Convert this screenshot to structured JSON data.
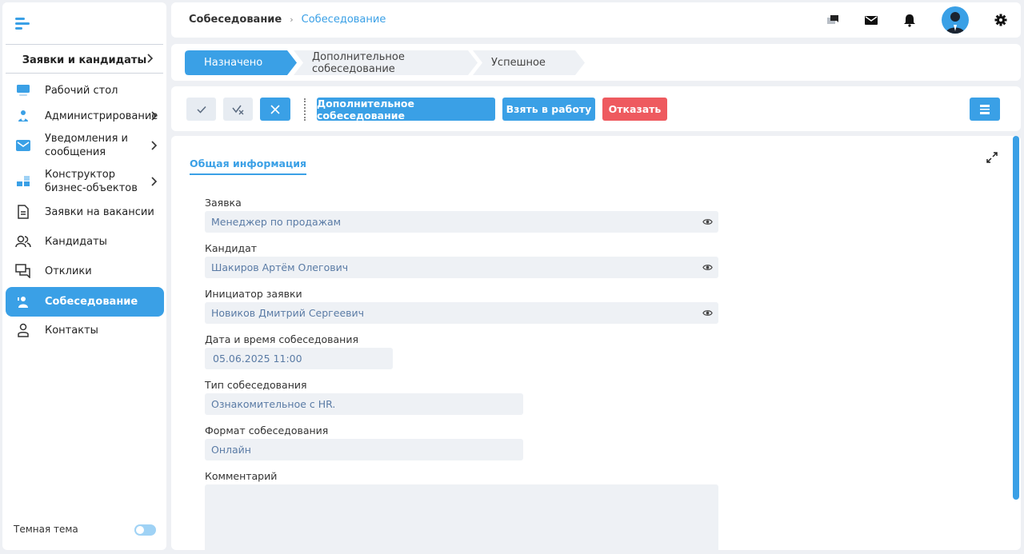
{
  "sidebar": {
    "section": "Заявки и кандидаты",
    "items": [
      {
        "label": "Рабочий стол",
        "icon": "monitor-icon"
      },
      {
        "label": "Администрирование",
        "icon": "admin-icon"
      },
      {
        "label": "Уведомления и сообщения",
        "icon": "mail-icon"
      },
      {
        "label": "Конструктор бизнес-объектов",
        "icon": "blocks-icon"
      },
      {
        "label": "Заявки на вакансии",
        "icon": "document-icon"
      },
      {
        "label": "Кандидаты",
        "icon": "users-icon"
      },
      {
        "label": "Отклики",
        "icon": "chat-icon"
      },
      {
        "label": "Собеседование",
        "icon": "interview-icon"
      },
      {
        "label": "Контакты",
        "icon": "contact-icon"
      }
    ],
    "theme_label": "Темная тема",
    "theme_enabled": false
  },
  "header": {
    "breadcrumb_root": "Собеседование",
    "breadcrumb_sep": "›",
    "breadcrumb_current": "Собеседование"
  },
  "stages": [
    {
      "label": "Назначено",
      "active": true
    },
    {
      "label": "Дополнительное собеседование",
      "active": false
    },
    {
      "label": "Успешное",
      "active": false
    }
  ],
  "toolbar": {
    "extra_interview_label": "Дополнительное собеседование",
    "take_to_work_label": "Взять в работу",
    "reject_label": "Отказать"
  },
  "form": {
    "tab_label": "Общая информация",
    "fields": [
      {
        "label": "Заявка",
        "value": "Менеджер по продажам"
      },
      {
        "label": "Кандидат",
        "value": "Шакиров Артём Олегович"
      },
      {
        "label": "Инициатор заявки",
        "value": "Новиков Дмитрий Сергеевич"
      },
      {
        "label": "Дата и время собеседования",
        "value": "05.06.2025 11:00"
      },
      {
        "label": "Тип собеседования",
        "value": "Ознакомительное с HR."
      },
      {
        "label": "Формат собеседования",
        "value": "Онлайн"
      },
      {
        "label": "Комментарий",
        "value": ""
      }
    ]
  },
  "colors": {
    "accent": "#3aa0e6",
    "danger": "#ee5a5f",
    "field_bg": "#eef1f5"
  }
}
